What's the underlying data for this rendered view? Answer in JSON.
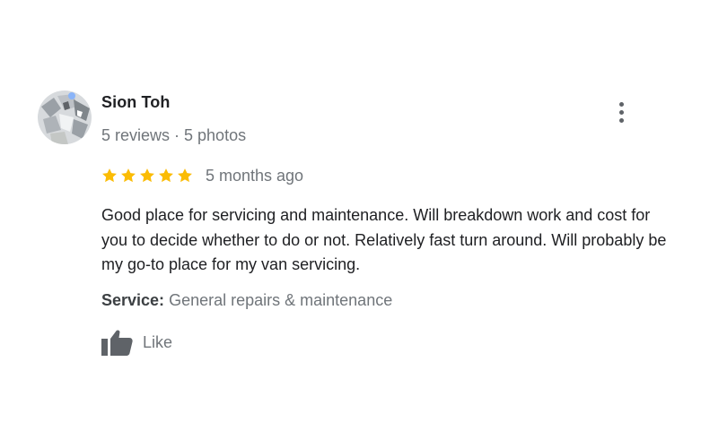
{
  "review": {
    "reviewer": {
      "name": "Sion Toh",
      "meta": "5 reviews · 5 photos"
    },
    "rating": 5,
    "rating_max": 5,
    "date": "5 months ago",
    "text": "Good place for servicing and maintenance. Will breakdown work and cost for you to decide whether to do or not. Relatively fast turn around. Will probably be my go-to place for my van servicing.",
    "service": {
      "label": "Service:",
      "value": "General repairs & maintenance"
    },
    "like_label": "Like"
  },
  "icons": {
    "star": "star-icon",
    "more": "more-vert-icon",
    "like": "thumbs-up-icon"
  },
  "colors": {
    "star": "#fbbc04",
    "text": "#202124",
    "muted": "#70757a",
    "icon": "#5f6368"
  }
}
